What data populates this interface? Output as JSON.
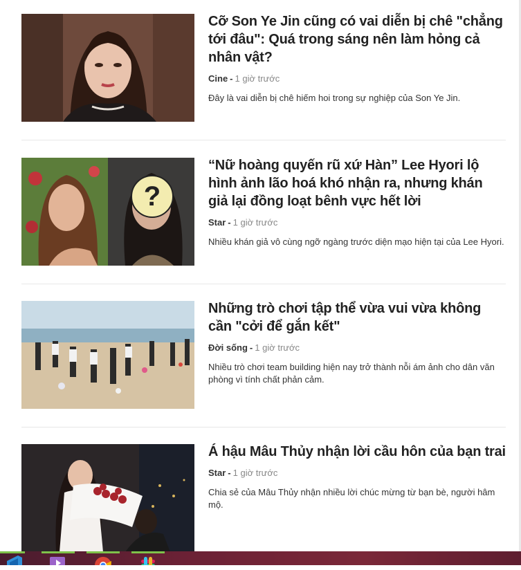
{
  "articles": [
    {
      "title": "Cỡ Son Ye Jin cũng có vai diễn bị chê \"chẳng tới đâu\": Quá trong sáng nên làm hỏng cả nhân vật?",
      "category": "Cine",
      "separator": "-",
      "time": "1 giờ trước",
      "summary": "Đây là vai diễn bị chê hiếm hoi trong sự nghiệp của Son Ye Jin."
    },
    {
      "title": "“Nữ hoàng quyến rũ xứ Hàn” Lee Hyori lộ hình ảnh lão hoá khó nhận ra, nhưng khán giả lại đồng loạt bênh vực hết lời",
      "category": "Star",
      "separator": "-",
      "time": "1 giờ trước",
      "summary": "Nhiều khán giả vô cùng ngỡ ngàng trước diện mạo hiện tại của Lee Hyori.",
      "thumb_overlay": "?"
    },
    {
      "title": "Những trò chơi tập thể vừa vui vừa không cần \"cởi để gắn kết\"",
      "category": "Đời sống",
      "separator": "-",
      "time": "1 giờ trước",
      "summary": "Nhiều trò chơi team building hiện nay trở thành nỗi ám ảnh cho dân văn phòng vì tính chất phản cảm."
    },
    {
      "title": "Á hậu Mâu Thủy nhận lời cầu hôn của bạn trai",
      "category": "Star",
      "separator": "-",
      "time": "1 giờ trước",
      "summary": "Chia sẻ của Mâu Thủy nhận nhiều lời chúc mừng từ bạn bè, người hâm mộ."
    }
  ],
  "taskbar": {
    "icons": [
      "vscode-icon",
      "media-player-icon",
      "chrome-icon",
      "slack-icon"
    ],
    "indicator_color": "#7fc24a"
  }
}
